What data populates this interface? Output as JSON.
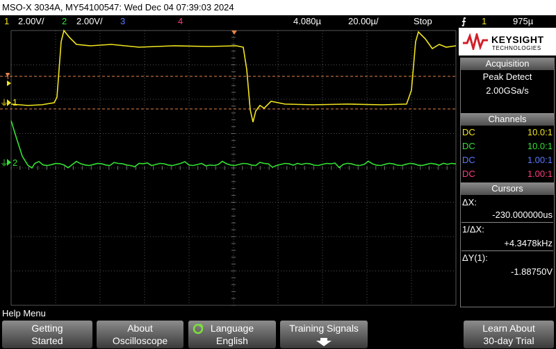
{
  "title_bar": {
    "text": "MSO-X 3034A, MY54100547: Wed Dec 04 07:39:03 2024"
  },
  "channel_bar": {
    "ch1_num": "1",
    "ch1_scale": "2.00V/",
    "ch2_num": "2",
    "ch2_scale": "2.00V/",
    "ch3_num": "3",
    "ch4_num": "4",
    "time_pos": "4.080µ",
    "time_scale": "20.00µ/",
    "run_state": "Stop",
    "trigger_icon": "trigger-edge-rising",
    "trig_ch": "1",
    "trig_level": "975µ"
  },
  "screen": {
    "ch1_marker": "1",
    "ch2_marker": "2",
    "trigger_marker": "T"
  },
  "colors": {
    "ch1": "#f2e61e",
    "ch2": "#33e233",
    "ch3": "#5a78ff",
    "ch4": "#ff3c7a",
    "cursor": "#e8834a"
  },
  "logo": {
    "brand": "KEYSIGHT",
    "sub": "TECHNOLOGIES"
  },
  "acquisition": {
    "header": "Acquisition",
    "mode": "Peak Detect",
    "rate": "2.00GSa/s"
  },
  "channels": {
    "header": "Channels",
    "rows": [
      {
        "coupling": "DC",
        "probe": "10.0:1"
      },
      {
        "coupling": "DC",
        "probe": "10.0:1"
      },
      {
        "coupling": "DC",
        "probe": "1.00:1"
      },
      {
        "coupling": "DC",
        "probe": "1.00:1"
      }
    ]
  },
  "cursors": {
    "header": "Cursors",
    "dx_label": "ΔX:",
    "dx_value": "-230.000000us",
    "inv_label": "1/ΔX:",
    "inv_value": "+4.3478kHz",
    "dy_label": "ΔY(1):",
    "dy_value": "-1.88750V"
  },
  "help_menu": {
    "label": "Help Menu"
  },
  "softkeys": [
    {
      "line1": "Getting",
      "line2": "Started"
    },
    {
      "line1": "About",
      "line2": "Oscilloscope"
    },
    {
      "line1": "Language",
      "line2": "English"
    },
    {
      "line1": "Training Signals",
      "line2": ""
    },
    {
      "line1": "Learn About",
      "line2": "30-day Trial"
    }
  ]
}
